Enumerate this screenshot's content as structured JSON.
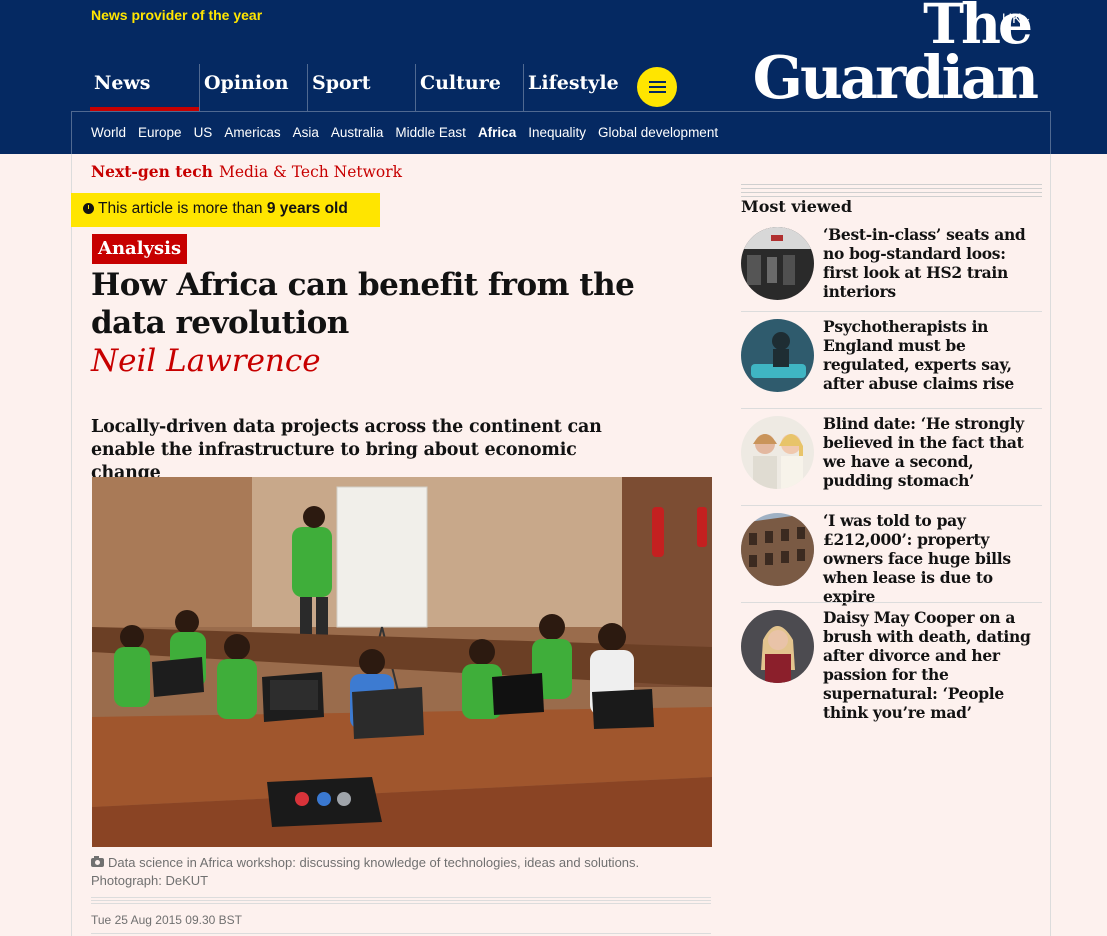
{
  "header": {
    "award": "News provider of the year",
    "edition": "UK",
    "logo_line1": "The",
    "logo_line2": "Guardian",
    "pillars": [
      {
        "label": "News"
      },
      {
        "label": "Opinion"
      },
      {
        "label": "Sport"
      },
      {
        "label": "Culture"
      },
      {
        "label": "Lifestyle"
      }
    ],
    "menu_icon": "hamburger-icon",
    "subnav": [
      "World",
      "Europe",
      "US",
      "Americas",
      "Asia",
      "Australia",
      "Middle East",
      "Africa",
      "Inequality",
      "Global development"
    ],
    "subnav_current": "Africa"
  },
  "article": {
    "series_kicker": "Next-gen tech",
    "series_name": "Media & Tech Network",
    "age_prefix": "This article is more than",
    "age_value": "9 years old",
    "badge": "Analysis",
    "headline": "How Africa can benefit from the data revolution",
    "byline": "Neil Lawrence",
    "standfirst": "Locally-driven data projects across the continent can enable the infrastructure to bring about economic change",
    "caption": "Data science in Africa workshop: discussing knowledge of technologies, ideas and solutions. Photograph: DeKUT",
    "date": "Tue 25 Aug 2015 09.30 BST"
  },
  "most_viewed": {
    "title": "Most viewed",
    "items": [
      {
        "headline": "‘Best-in-class’ seats and no bog-standard loos: first look at HS2 train interiors"
      },
      {
        "headline": "Psychotherapists in England must be regulated, experts say, after abuse claims rise"
      },
      {
        "headline": "Blind date: ‘He strongly believed in the fact that we have a second, pudding stomach’"
      },
      {
        "headline": "‘I was told to pay £212,000’: property owners face huge bills when lease is due to expire"
      },
      {
        "headline": "Daisy May Cooper on a brush with death, dating after divorce and her passion for the supernatural: ‘People think you’re mad’"
      }
    ]
  },
  "colors": {
    "brand_blue": "#052962",
    "news_red": "#c70000",
    "highlight_yellow": "#ffe500",
    "page_background": "#fdf1ee"
  }
}
